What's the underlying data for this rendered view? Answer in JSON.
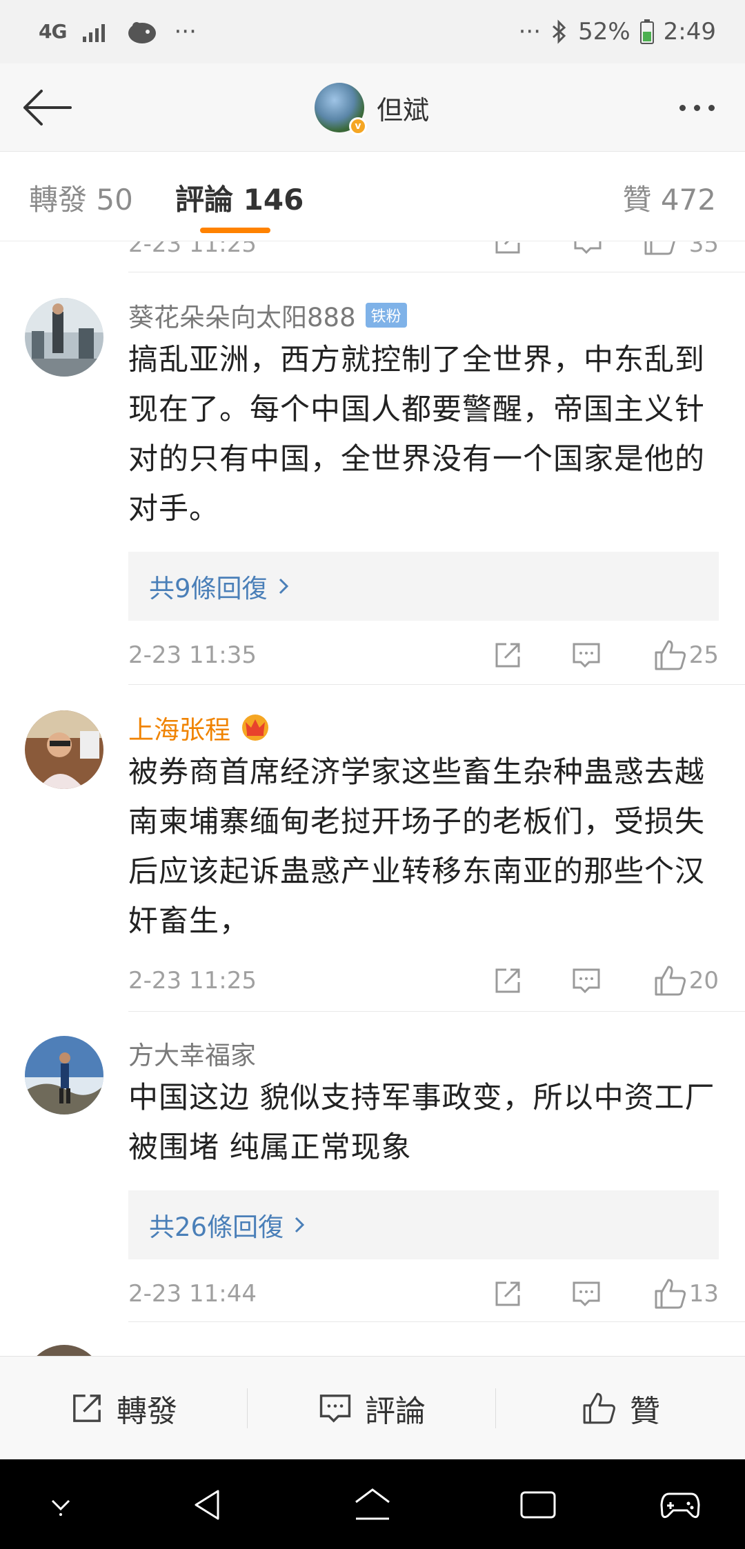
{
  "status_bar": {
    "network": "4G",
    "battery": "52%",
    "time": "2:49",
    "left_more": "···",
    "right_more": "···"
  },
  "header": {
    "author_name": "但斌",
    "verified_badge": "v"
  },
  "tabs": {
    "repost": "轉發 50",
    "comment": "評論 146",
    "like": "贊 472"
  },
  "partial_top": {
    "time": "2-23 11:25",
    "likes": "35"
  },
  "comments": [
    {
      "name": "葵花朵朵向太阳888",
      "badge": "铁粉",
      "text": "搞乱亚洲，西方就控制了全世界，中东乱到现在了。每个中国人都要警醒，帝国主义针对的只有中国，全世界没有一个国家是他的对手。",
      "replies": "共9條回復",
      "time": "2-23 11:35",
      "likes": "25"
    },
    {
      "name": "上海张程",
      "text": "被券商首席经济学家这些畜生杂种蛊惑去越南柬埔寨缅甸老挝开场子的老板们，受损失后应该起诉蛊惑产业转移东南亚的那些个汉奸畜生，",
      "time": "2-23 11:25",
      "likes": "20"
    },
    {
      "name": "方大幸福家",
      "text": "中国这边 貌似支持军事政变，所以中资工厂被围堵 纯属正常现象",
      "replies": "共26條回復",
      "time": "2-23 11:44",
      "likes": "13"
    }
  ],
  "action_bar": {
    "repost": "轉發",
    "comment": "評論",
    "like": "贊"
  },
  "icons": {
    "back": "arrow-left-icon",
    "more": "more-dots-icon",
    "share": "share-icon",
    "comment": "comment-icon",
    "like": "thumbs-up-icon",
    "chevron": "chevron-right-icon"
  },
  "colors": {
    "accent": "#ff8200",
    "link": "#4a7fb8",
    "gold_name": "#f08300"
  }
}
